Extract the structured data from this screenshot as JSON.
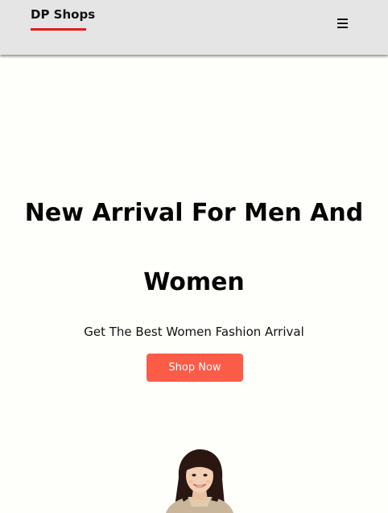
{
  "navbar": {
    "brand": "DP Shops",
    "menu_icon": "hamburger-menu-icon"
  },
  "hero": {
    "title_line1": "New Arrival For Men And",
    "title_line2": "Women",
    "subtitle": "Get The Best Women Fashion Arrival",
    "cta_label": "Shop Now",
    "cta_color": "#fb5c48",
    "model_image": "smiling-woman-model-image"
  },
  "colors": {
    "navbar_bg": "#e5e5e5",
    "brand_underline": "#e41b1b",
    "page_bg": "#fefefa"
  }
}
